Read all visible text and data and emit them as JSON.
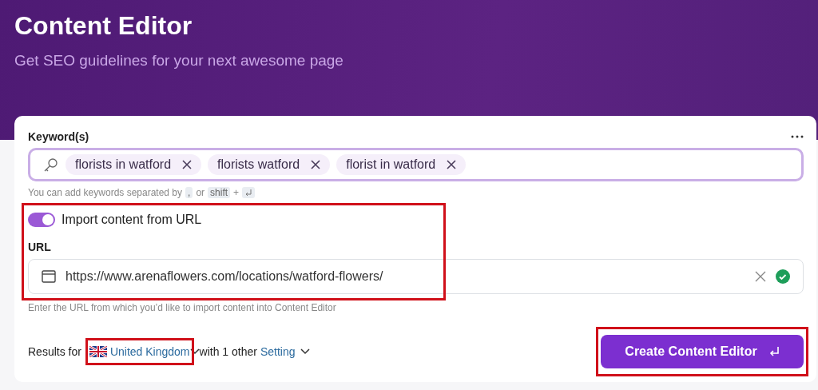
{
  "header": {
    "title": "Content Editor",
    "subtitle": "Get SEO guidelines for your next awesome page"
  },
  "keywords": {
    "label": "Keyword(s)",
    "chips": [
      {
        "text": "florists in watford"
      },
      {
        "text": "florists watford"
      },
      {
        "text": "florist in watford"
      }
    ],
    "hint": {
      "text1": "You can add keywords separated by",
      "key1": ",",
      "text2": "or",
      "key2": "shift",
      "plus": "+"
    }
  },
  "import": {
    "on": true,
    "label": "Import content from URL",
    "highlighted": true
  },
  "url": {
    "label": "URL",
    "value": "https://www.arenaflowers.com/locations/watford-flowers/",
    "valid": true,
    "helper": "Enter the URL from which you’d like to import content into Content Editor"
  },
  "results": {
    "prefix": "Results for",
    "country": "United Kingdom",
    "country_highlighted": true,
    "middle": "with 1 other",
    "setting": "Setting"
  },
  "create_button": {
    "label": "Create Content Editor",
    "highlighted": true
  }
}
